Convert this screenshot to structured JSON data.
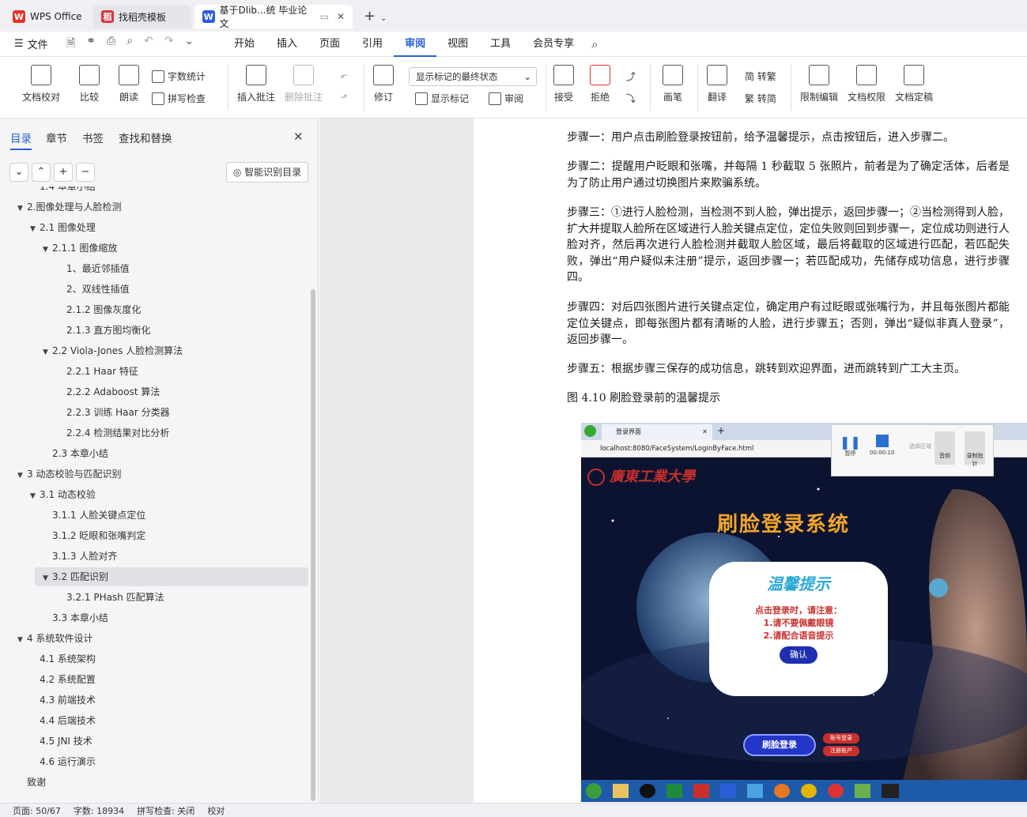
{
  "tabs": [
    {
      "label": "WPS Office"
    },
    {
      "label": "找稻壳模板"
    },
    {
      "label": "基于Dlib...统 毕业论文"
    }
  ],
  "menu": {
    "file": "文件",
    "items": [
      "开始",
      "插入",
      "页面",
      "引用",
      "审阅",
      "视图",
      "工具",
      "会员专享"
    ],
    "active_index": 4
  },
  "ribbon": {
    "doc_check": "文档校对",
    "compare": "比较",
    "read": "朗读",
    "word_count": "字数统计",
    "spell_check": "拼写检查",
    "insert_comment": "插入批注",
    "delete_comment": "删除批注",
    "revise": "修订",
    "show_markup": "显示标记",
    "review": "审阅",
    "markup_state": "显示标记的最终状态",
    "accept": "接受",
    "reject": "拒绝",
    "pen": "画笔",
    "translate": "翻译",
    "to_traditional": "简 转繁",
    "to_simplified": "繁 转简",
    "restrict_edit": "限制编辑",
    "doc_permission": "文档权限",
    "doc_finalize": "文档定稿"
  },
  "panel": {
    "tabs": [
      "目录",
      "章节",
      "书签",
      "查找和替换"
    ],
    "smart_toc": "智能识别目录",
    "toc": [
      {
        "label": "1.4 本章小结",
        "level": 2,
        "arrow": ""
      },
      {
        "label": "2.图像处理与人脸检测",
        "level": 1,
        "arrow": "▼"
      },
      {
        "label": "2.1 图像处理",
        "level": 2,
        "arrow": "▼"
      },
      {
        "label": "2.1.1 图像缩放",
        "level": 3,
        "arrow": "▼"
      },
      {
        "label": "1、最近邻插值",
        "level": 4,
        "arrow": ""
      },
      {
        "label": "2、双线性插值",
        "level": 4,
        "arrow": ""
      },
      {
        "label": "2.1.2 图像灰度化",
        "level": 4,
        "arrow": ""
      },
      {
        "label": "2.1.3 直方图均衡化",
        "level": 4,
        "arrow": ""
      },
      {
        "label": "2.2 Viola-Jones 人脸检测算法",
        "level": 3,
        "arrow": "▼"
      },
      {
        "label": "2.2.1 Haar 特征",
        "level": 4,
        "arrow": ""
      },
      {
        "label": "2.2.2 Adaboost 算法",
        "level": 4,
        "arrow": ""
      },
      {
        "label": "2.2.3 训练 Haar 分类器",
        "level": 4,
        "arrow": ""
      },
      {
        "label": "2.2.4 检测结果对比分析",
        "level": 4,
        "arrow": ""
      },
      {
        "label": "2.3 本章小结",
        "level": 3,
        "arrow": ""
      },
      {
        "label": "3 动态校验与匹配识别",
        "level": 1,
        "arrow": "▼"
      },
      {
        "label": "3.1 动态校验",
        "level": 2,
        "arrow": "▼"
      },
      {
        "label": "3.1.1 人脸关键点定位",
        "level": 3,
        "arrow": ""
      },
      {
        "label": "3.1.2 眨眼和张嘴判定",
        "level": 3,
        "arrow": ""
      },
      {
        "label": "3.1.3 人脸对齐",
        "level": 3,
        "arrow": ""
      },
      {
        "label": "3.2 匹配识别",
        "level": 3,
        "arrow": "▼",
        "selected": true
      },
      {
        "label": "3.2.1 PHash 匹配算法",
        "level": 4,
        "arrow": ""
      },
      {
        "label": "3.3 本章小结",
        "level": 3,
        "arrow": ""
      },
      {
        "label": "4 系统软件设计",
        "level": 1,
        "arrow": "▼"
      },
      {
        "label": "4.1 系统架构",
        "level": 2,
        "arrow": ""
      },
      {
        "label": "4.2 系统配置",
        "level": 2,
        "arrow": ""
      },
      {
        "label": "4.3 前端技术",
        "level": 2,
        "arrow": ""
      },
      {
        "label": "4.4 后端技术",
        "level": 2,
        "arrow": ""
      },
      {
        "label": "4.5 JNI 技术",
        "level": 2,
        "arrow": ""
      },
      {
        "label": "4.6 运行演示",
        "level": 2,
        "arrow": ""
      },
      {
        "label": "致谢",
        "level": 1,
        "arrow": ""
      }
    ]
  },
  "doc": {
    "p1": "步骤一：用户点击刷脸登录按钮前，给予温馨提示，点击按钮后，进入步骤二。",
    "p2": "步骤二：提醒用户眨眼和张嘴，并每隔 1 秒截取 5 张照片，前者是为了确定活体，后者是为了防止用户通过切换图片来欺骗系统。",
    "p3": "步骤三：①进行人脸检测，当检测不到人脸，弹出提示，返回步骤一；②当检测得到人脸，扩大并提取人脸所在区域进行人脸关键点定位，定位失败则回到步骤一，定位成功则进行人脸对齐，然后再次进行人脸检测并截取人脸区域，最后将截取的区域进行匹配，若匹配失败，弹出“用户疑似未注册”提示，返回步骤一；若匹配成功，先储存成功信息，进行步骤四。",
    "p4": "步骤四：对后四张图片进行关键点定位，确定用户有过眨眼或张嘴行为，并且每张图片都能定位关键点，即每张图片都有清晰的人脸，进行步骤五；否则，弹出“疑似非真人登录”，返回步骤一。",
    "p5": "步骤五：根据步骤三保存的成功信息，跳转到欢迎界面，进而跳转到广工大主页。",
    "caption": "图 4.10 刷脸登录前的温馨提示"
  },
  "screenshot": {
    "tab_label": "登录界面",
    "url": "localhost:8080/FaceSystem/LoginByFace.html",
    "school": "廣東工業大學",
    "title": "刷脸登录系统",
    "tip_title": "温馨提示",
    "tip1": "点击登录时，请注意：",
    "tip2": "1.请不要佩戴眼镜",
    "tip3": "2.请配合语音提示",
    "confirm": "确认",
    "login_btn": "刷脸登录",
    "account_login": "账号登录",
    "register": "注册账户",
    "rec_pause": "暂停",
    "rec_time": "00:00:10",
    "rec_area": "选择区域",
    "rec_audio": "音频",
    "rec_pointer": "录制指针"
  },
  "status": {
    "page": "页面: 50/67",
    "words": "字数: 18934",
    "spell": "拼写检查: 关闭",
    "proof": "校对"
  },
  "colors": {
    "accent": "#2b5fd9",
    "wps_red": "#e8322a",
    "doc_blue": "#2b5fd9"
  }
}
